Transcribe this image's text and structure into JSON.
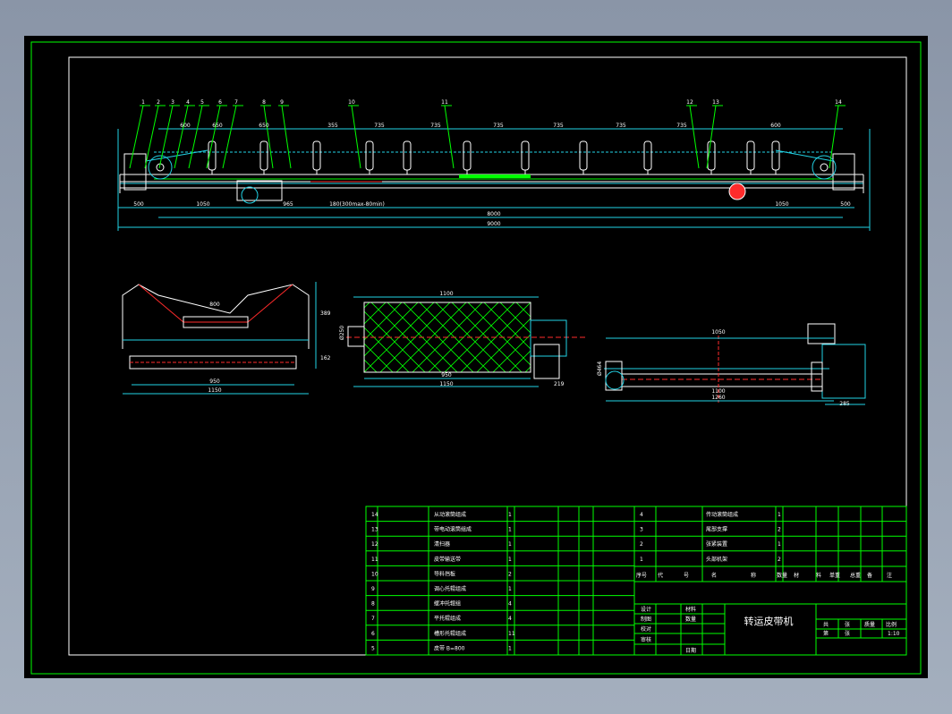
{
  "drawing": {
    "title": "转运皮带机",
    "scale": "1:10"
  },
  "top_view": {
    "balloons": [
      "1",
      "2",
      "3",
      "4",
      "5",
      "6",
      "7",
      "8",
      "9",
      "10",
      "11",
      "12",
      "13",
      "14"
    ],
    "top_dims": [
      "600",
      "650",
      "650",
      "355",
      "735",
      "735",
      "735",
      "735",
      "735",
      "735",
      "600"
    ],
    "bottom_dims": [
      "500",
      "1050",
      "965",
      "180(300max-80min)",
      "1050",
      "500"
    ],
    "total_inner": "8000",
    "total_outer": "9000"
  },
  "idler_view": {
    "dims": [
      "800",
      "389",
      "162",
      "950",
      "1150"
    ]
  },
  "pulley_view": {
    "dims": [
      "1100",
      "950",
      "1150",
      "219",
      "Ø250"
    ]
  },
  "drive_view": {
    "dims": [
      "1050",
      "Ø464",
      "1100",
      "1260",
      "285"
    ]
  },
  "parts": [
    {
      "no": "14",
      "name": "从动滚筒组成",
      "qty": "1"
    },
    {
      "no": "13",
      "name": "带电动滚筒组成",
      "qty": "1"
    },
    {
      "no": "12",
      "name": "清扫器",
      "qty": "1"
    },
    {
      "no": "11",
      "name": "皮带输送带",
      "qty": "1"
    },
    {
      "no": "10",
      "name": "导料挡板",
      "qty": "2"
    },
    {
      "no": "9",
      "name": "调心托辊组成",
      "qty": "1"
    },
    {
      "no": "8",
      "name": "缓冲托辊组",
      "qty": "4"
    },
    {
      "no": "7",
      "name": "平托辊组成",
      "qty": "4"
    },
    {
      "no": "6",
      "name": "槽形托辊组成",
      "qty": "11"
    },
    {
      "no": "5",
      "name": "皮带  B=800",
      "qty": "1"
    }
  ],
  "parts_right": [
    {
      "no": "4",
      "name": "传动滚筒组成",
      "qty": "1"
    },
    {
      "no": "3",
      "name": "尾部支撑",
      "qty": "2"
    },
    {
      "no": "2",
      "name": "张紧装置",
      "qty": "1"
    },
    {
      "no": "1",
      "name": "头部机架",
      "qty": "2"
    }
  ],
  "header_row": [
    "序号",
    "代",
    "号",
    "名",
    "称",
    "数量",
    "材",
    "料",
    "单重",
    "总重",
    "备",
    "注"
  ],
  "title_block": {
    "designer": "设计",
    "drafter": "制图",
    "checker": "校对",
    "reviewer": "审核",
    "material_label": "材料",
    "quantity_label": "数量",
    "date_label": "日期",
    "stage_labels": [
      "共",
      "张",
      "质量",
      "比例"
    ],
    "sheet_labels": [
      "第",
      "张"
    ]
  }
}
